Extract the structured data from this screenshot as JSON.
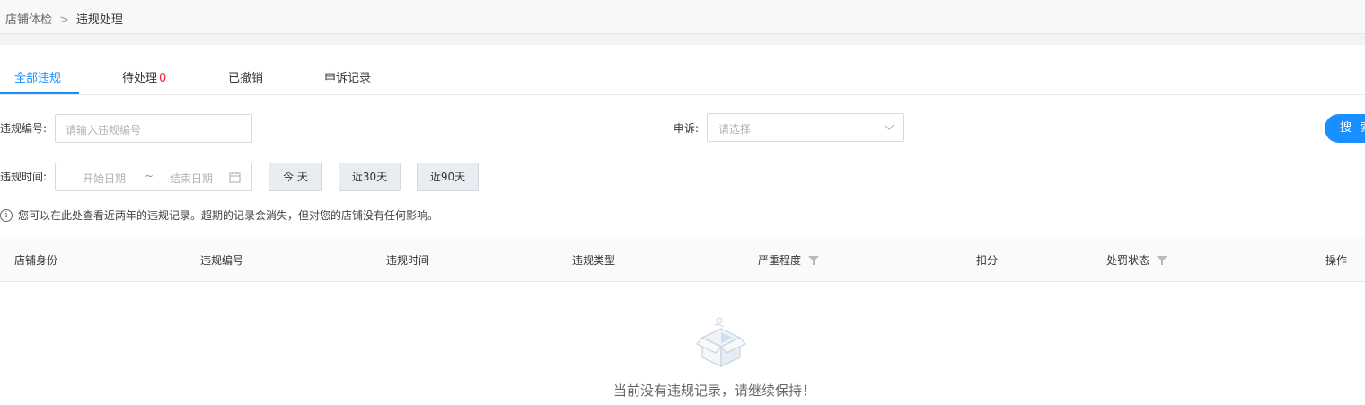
{
  "breadcrumb": {
    "parent": "店铺体检",
    "separator": ">",
    "current": "违规处理"
  },
  "tabs": [
    {
      "label": "全部违规",
      "active": true
    },
    {
      "label": "待处理",
      "count": "0"
    },
    {
      "label": "已撤销"
    },
    {
      "label": "申诉记录"
    }
  ],
  "filters": {
    "violation_no_label": "违规编号:",
    "violation_no_placeholder": "请输入违规编号",
    "appeal_label": "申诉:",
    "appeal_placeholder": "请选择",
    "time_label": "违规时间:",
    "start_placeholder": "开始日期",
    "range_sep": "~",
    "end_placeholder": "结束日期",
    "quick_today": "今 天",
    "quick_30": "近30天",
    "quick_90": "近90天",
    "search_button": "搜 索"
  },
  "notice": "您可以在此处查看近两年的违规记录。超期的记录会消失，但对您的店铺没有任何影响。",
  "table": {
    "columns": [
      "店铺身份",
      "违规编号",
      "违规时间",
      "违规类型",
      "严重程度",
      "扣分",
      "处罚状态",
      "操作"
    ]
  },
  "empty_message": "当前没有违规记录，请继续保持！",
  "colors": {
    "primary": "#1890ff",
    "danger": "#f5222d"
  }
}
